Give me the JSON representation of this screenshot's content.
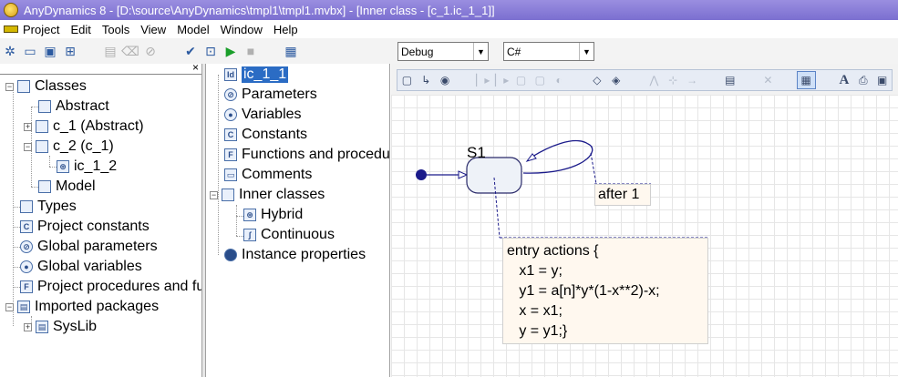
{
  "window": {
    "title": "AnyDynamics 8 - [D:\\source\\AnyDynamics\\tmpl1\\tmpl1.mvbx] - [Inner class - [c_1.ic_1_1]]"
  },
  "menu": [
    "Project",
    "Edit",
    "Tools",
    "View",
    "Model",
    "Window",
    "Help"
  ],
  "toolbar": {
    "config_select": "Debug",
    "language_select": "C#"
  },
  "left_tree": {
    "close": "×",
    "items": [
      {
        "label": "Classes",
        "icon": "folder-icon"
      },
      {
        "label": "Abstract",
        "icon": "class-icon"
      },
      {
        "label": "c_1 (Abstract)",
        "icon": "class-icon"
      },
      {
        "label": "c_2 (c_1)",
        "icon": "class-icon"
      },
      {
        "label": "ic_1_2",
        "icon": "hybrid-icon"
      },
      {
        "label": "Model",
        "icon": "class-icon"
      },
      {
        "label": "Types",
        "icon": "folder-icon"
      },
      {
        "label": "Project constants",
        "icon": "constant-icon"
      },
      {
        "label": "Global parameters",
        "icon": "parameter-icon"
      },
      {
        "label": "Global variables",
        "icon": "variable-icon"
      },
      {
        "label": "Project procedures and functions",
        "icon": "function-icon"
      },
      {
        "label": "Imported packages",
        "icon": "package-icon"
      },
      {
        "label": "SysLib",
        "icon": "package-icon"
      }
    ]
  },
  "mid_tree": {
    "items": [
      {
        "label": "ic_1_1",
        "icon": "id-icon"
      },
      {
        "label": "Parameters",
        "icon": "parameter-icon"
      },
      {
        "label": "Variables",
        "icon": "variable-icon"
      },
      {
        "label": "Constants",
        "icon": "constant-icon"
      },
      {
        "label": "Functions and procedures",
        "icon": "function-icon"
      },
      {
        "label": "Comments",
        "icon": "comment-icon"
      },
      {
        "label": "Inner classes",
        "icon": "folder-icon"
      },
      {
        "label": "Hybrid",
        "icon": "hybrid-icon"
      },
      {
        "label": "Continuous",
        "icon": "continuous-icon"
      },
      {
        "label": "Instance properties",
        "icon": "properties-icon"
      }
    ]
  },
  "diagram": {
    "state_name": "S1",
    "transition_label": "after 1",
    "note": "entry actions {\n   x1 = y;\n   y1 = a[n]*y*(1-x**2)-x;\n   x = x1;\n   y = y1;}"
  },
  "colors": {
    "title_bar": "#8b7fd8",
    "selection": "#2b6cc4",
    "note_bg": "#fff8ef"
  }
}
